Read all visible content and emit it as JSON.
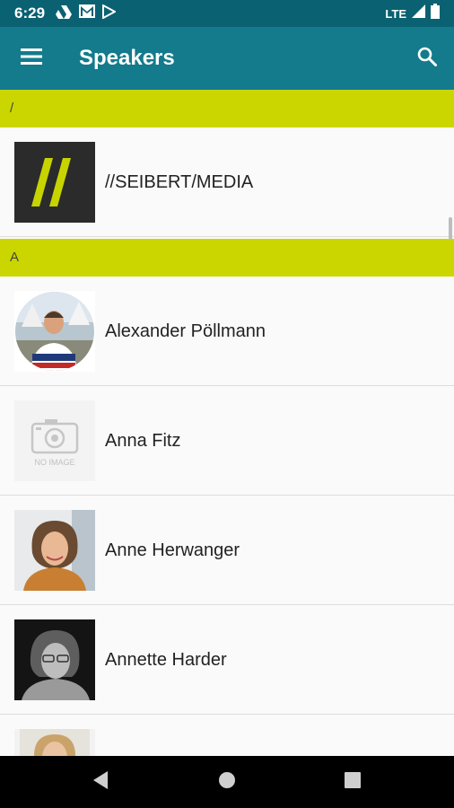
{
  "status": {
    "time": "6:29",
    "network": "LTE",
    "icons": [
      "drive-icon",
      "gmail-icon",
      "play-store-icon",
      "signal-icon",
      "battery-icon"
    ]
  },
  "appbar": {
    "title": "Speakers",
    "menu_icon": "menu-icon",
    "search_icon": "search-icon"
  },
  "sections": [
    {
      "header": "/"
    },
    {
      "header": "A"
    }
  ],
  "speakers": [
    {
      "name": "//SEIBERT/MEDIA",
      "avatar": "logo"
    },
    {
      "name": "Alexander Pöllmann",
      "avatar": "photo-round"
    },
    {
      "name": "Anna Fitz",
      "avatar": "placeholder",
      "placeholder_text": "NO IMAGE"
    },
    {
      "name": "Anne Herwanger",
      "avatar": "photo"
    },
    {
      "name": "Annette Harder",
      "avatar": "photo-bw"
    },
    {
      "name": "",
      "avatar": "photo-partial"
    }
  ],
  "colors": {
    "status_bar": "#0a6171",
    "app_bar": "#137b8b",
    "section_header": "#cbd600"
  }
}
